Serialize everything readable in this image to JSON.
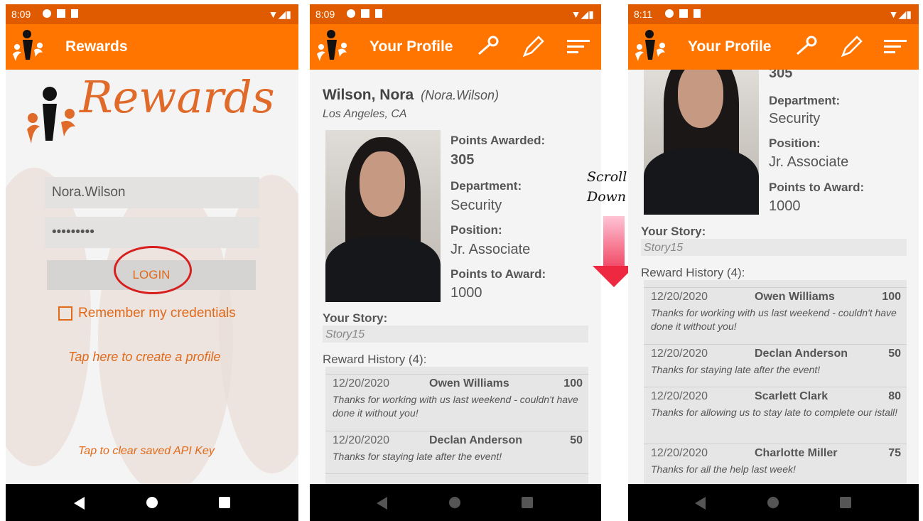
{
  "screens": [
    {
      "status": {
        "time": "8:09"
      },
      "appbar": {
        "title": "Rewards"
      },
      "logo_word": "Rewards",
      "login": {
        "username": "Nora.Wilson",
        "password": "•••••••••",
        "button": "LOGIN"
      },
      "remember": "Remember my credentials",
      "create_profile": "Tap here to create a profile",
      "clear_key": "Tap to clear saved API Key"
    },
    {
      "status": {
        "time": "8:09"
      },
      "appbar": {
        "title": "Your Profile"
      },
      "name": "Wilson, Nora",
      "username": "(Nora.Wilson)",
      "location": "Los Angeles, CA",
      "points_awarded_label": "Points Awarded:",
      "points_awarded": "305",
      "department_label": "Department:",
      "department": "Security",
      "position_label": "Position:",
      "position": "Jr. Associate",
      "points_to_award_label": "Points to Award:",
      "points_to_award": "1000",
      "story_label": "Your Story:",
      "story": "Story15",
      "history_title": "Reward History (4):",
      "history": [
        {
          "date": "12/20/2020",
          "name": "Owen Williams",
          "points": "100",
          "msg": "Thanks for working with us last weekend - couldn't have done it without you!"
        },
        {
          "date": "12/20/2020",
          "name": "Declan Anderson",
          "points": "50",
          "msg": "Thanks for staying late after the event!"
        }
      ]
    },
    {
      "status": {
        "time": "8:11"
      },
      "appbar": {
        "title": "Your Profile"
      },
      "points_awarded": "305",
      "department_label": "Department:",
      "department": "Security",
      "position_label": "Position:",
      "position": "Jr. Associate",
      "points_to_award_label": "Points to Award:",
      "points_to_award": "1000",
      "story_label": "Your Story:",
      "story": "Story15",
      "history_title": "Reward History (4):",
      "history": [
        {
          "date": "12/20/2020",
          "name": "Owen Williams",
          "points": "100",
          "msg": "Thanks for working with us last weekend - couldn't have done it without you!"
        },
        {
          "date": "12/20/2020",
          "name": "Declan Anderson",
          "points": "50",
          "msg": "Thanks for staying late after the event!"
        },
        {
          "date": "12/20/2020",
          "name": "Scarlett Clark",
          "points": "80",
          "msg": "Thanks for allowing us to stay late to complete our istall!"
        },
        {
          "date": "12/20/2020",
          "name": "Charlotte Miller",
          "points": "75",
          "msg": "Thanks for all the help last week!"
        }
      ]
    }
  ],
  "annotation": {
    "line1": "Scroll",
    "line2": "Down"
  },
  "colors": {
    "appbar": "#ff7500",
    "statusbar": "#e05a00",
    "accent": "#e06a1a",
    "highlight_circle": "#d61f1f",
    "arrow": "#ee2840"
  }
}
